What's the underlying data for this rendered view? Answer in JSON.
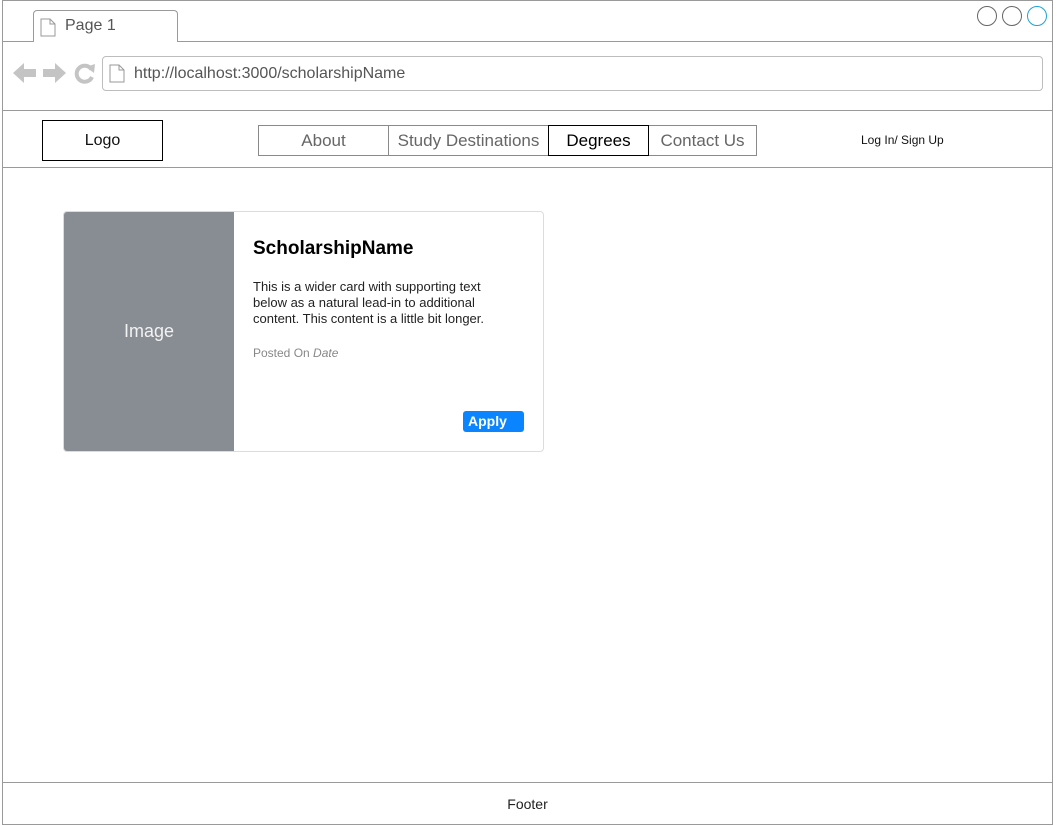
{
  "browser": {
    "tab_title": "Page 1",
    "url": "http://localhost:3000/scholarshipName"
  },
  "header": {
    "logo": "Logo",
    "nav": [
      {
        "label": "About",
        "active": false
      },
      {
        "label": "Study Destinations",
        "active": false
      },
      {
        "label": "Degrees",
        "active": true
      },
      {
        "label": "Contact Us",
        "active": false
      }
    ],
    "login": "Log In/ Sign Up"
  },
  "card": {
    "image_label": "Image",
    "title": "ScholarshipName",
    "text": "This is a wider card with supporting text below as a natural lead-in to additional content. This content is a little bit longer.",
    "posted_prefix": "Posted On",
    "posted_date": "Date",
    "apply_label": "Apply"
  },
  "footer": {
    "label": "Footer"
  },
  "colors": {
    "accent": "#0a85ff",
    "image_placeholder": "#878d93"
  }
}
